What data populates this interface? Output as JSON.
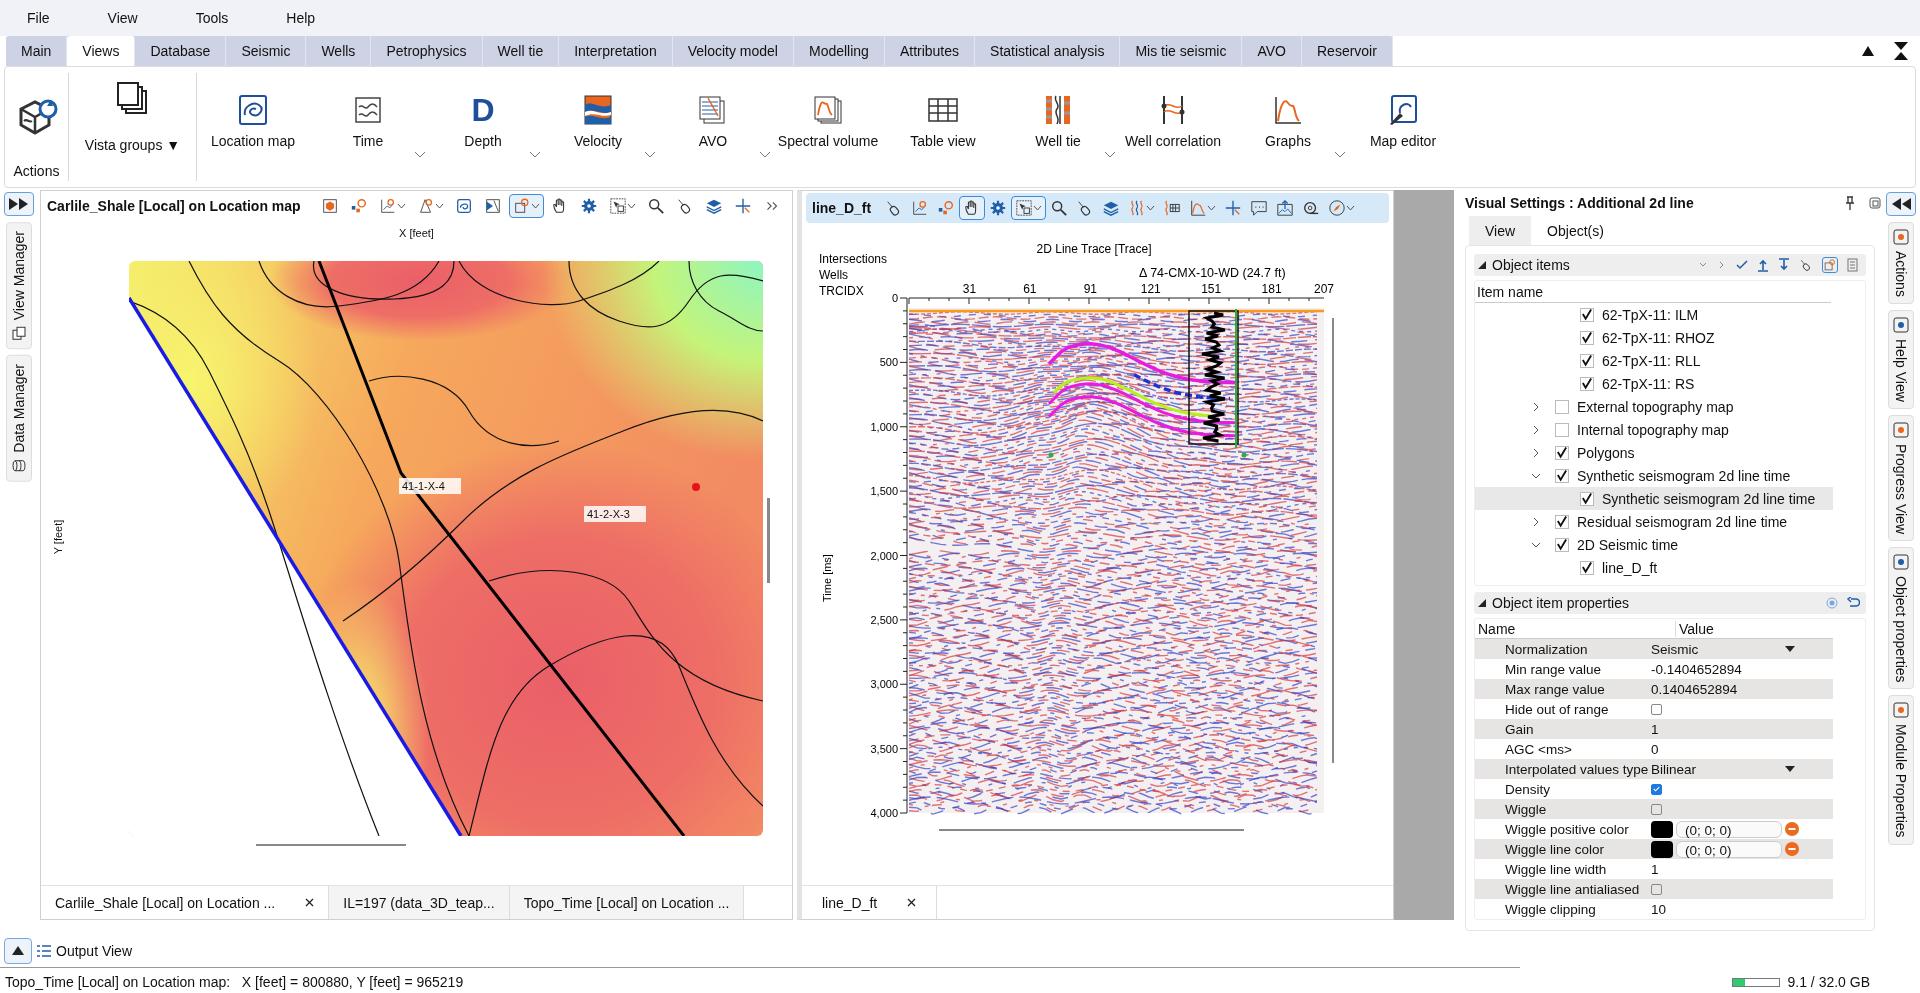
{
  "menu": [
    "File",
    "View",
    "Tools",
    "Help"
  ],
  "tabs": [
    {
      "label": "Main",
      "selected": false
    },
    {
      "label": "Views",
      "selected": true
    },
    {
      "label": "Database",
      "selected": false
    },
    {
      "label": "Seismic",
      "selected": false
    },
    {
      "label": "Wells",
      "selected": false
    },
    {
      "label": "Petrophysics",
      "selected": false
    },
    {
      "label": "Well tie",
      "selected": false
    },
    {
      "label": "Interpretation",
      "selected": false
    },
    {
      "label": "Velocity model",
      "selected": false
    },
    {
      "label": "Modelling",
      "selected": false
    },
    {
      "label": "Attributes",
      "selected": false
    },
    {
      "label": "Statistical analysis",
      "selected": false
    },
    {
      "label": "Mis tie seismic",
      "selected": false
    },
    {
      "label": "AVO",
      "selected": false
    },
    {
      "label": "Reservoir",
      "selected": false
    }
  ],
  "ribbon": {
    "actions_label": "Actions",
    "vista_groups": "Vista groups ▼",
    "buttons": [
      {
        "label": "Location map",
        "dropdown": false
      },
      {
        "label": "Time",
        "dropdown": true
      },
      {
        "label": "Depth",
        "dropdown": true,
        "glyph": "D"
      },
      {
        "label": "Velocity",
        "dropdown": true
      },
      {
        "label": "AVO",
        "dropdown": true
      },
      {
        "label": "Spectral volume",
        "dropdown": false
      },
      {
        "label": "Table view",
        "dropdown": false
      },
      {
        "label": "Well tie",
        "dropdown": true
      },
      {
        "label": "Well correlation",
        "dropdown": false
      },
      {
        "label": "Graphs",
        "dropdown": true
      },
      {
        "label": "Map editor",
        "dropdown": false
      }
    ]
  },
  "left_sidebar": [
    "View Manager",
    "Data Manager"
  ],
  "map_view": {
    "title": "Carlile_Shale [Local] on Location map",
    "toolbar": [
      {
        "selected": false
      },
      {
        "selected": false
      },
      {
        "selected": false
      },
      {
        "selected": false
      },
      {
        "selected": false
      },
      {
        "selected": false
      },
      {
        "selected": true
      },
      {
        "selected": false
      },
      {
        "selected": false
      },
      {
        "selected": false
      },
      {
        "selected": false
      },
      {
        "selected": false
      },
      {
        "selected": false
      },
      {
        "selected": false
      },
      {
        "selected": false
      }
    ],
    "x_axis": "X [feet]",
    "y_axis": "Y [feet]",
    "wells": [
      "41-1-X-4",
      "41-2-X-3"
    ],
    "tabs": [
      {
        "label": "Carlile_Shale [Local] on Location ...",
        "selected": true
      },
      {
        "label": "IL=197 (data_3D_teap...",
        "selected": false
      },
      {
        "label": "Topo_Time [Local] on Location ...",
        "selected": false
      }
    ]
  },
  "seismic_view": {
    "title": "line_D_ft",
    "toolbar": [
      {
        "selected": false
      },
      {
        "selected": false
      },
      {
        "selected": false
      },
      {
        "selected": true
      },
      {
        "selected": false
      },
      {
        "selected": true
      },
      {
        "selected": false
      },
      {
        "selected": false
      },
      {
        "selected": false
      },
      {
        "selected": false
      },
      {
        "selected": false
      },
      {
        "selected": false
      },
      {
        "selected": false
      },
      {
        "selected": false
      },
      {
        "selected": false
      },
      {
        "selected": false
      },
      {
        "selected": false
      }
    ],
    "x_axis": "2D Line Trace [Trace]",
    "row_labels": [
      "Intersections",
      "Wells",
      "TRCIDX"
    ],
    "well_marker": "Δ 74-CMX-10-WD (24.7 ft)",
    "xticks": [
      "31",
      "61",
      "91",
      "121",
      "151",
      "181",
      "207"
    ],
    "yticks": [
      "0",
      "500",
      "1,000",
      "1,500",
      "2,000",
      "2,500",
      "3,000",
      "3,500",
      "4,000"
    ],
    "y_axis": "Time [ms]",
    "tabs": [
      {
        "label": "line_D_ft",
        "selected": true
      }
    ]
  },
  "visual_settings": {
    "title": "Visual Settings : Additional 2d line",
    "tabs": [
      {
        "label": "View",
        "selected": true
      },
      {
        "label": "Object(s)",
        "selected": false
      }
    ],
    "object_items": {
      "title": "Object items",
      "column": "Item name",
      "continued_children": [
        {
          "label": "62-TpX-11: ILM",
          "checked": true,
          "selected": false
        },
        {
          "label": "62-TpX-11: RHOZ",
          "checked": true,
          "selected": false
        },
        {
          "label": "62-TpX-11: RLL",
          "checked": true,
          "selected": false
        },
        {
          "label": "62-TpX-11: RS",
          "checked": true,
          "selected": false
        }
      ],
      "items": [
        {
          "label": "External topography map",
          "checked": false,
          "expanded": false,
          "selected": false
        },
        {
          "label": "Internal topography map",
          "checked": false,
          "expanded": false,
          "selected": false
        },
        {
          "label": "Polygons",
          "checked": true,
          "expanded": false,
          "selected": false
        },
        {
          "label": "Synthetic seismogram 2d line time",
          "checked": true,
          "expanded": true,
          "selected": false,
          "children": [
            {
              "label": "Synthetic seismogram 2d line time",
              "checked": true,
              "selected": true
            }
          ]
        },
        {
          "label": "Residual seismogram 2d line time",
          "checked": true,
          "expanded": false,
          "selected": false
        },
        {
          "label": "2D Seismic time",
          "checked": true,
          "expanded": true,
          "selected": false,
          "children": [
            {
              "label": "line_D_ft",
              "checked": true,
              "selected": false
            }
          ]
        }
      ]
    },
    "properties": {
      "title": "Object item properties",
      "columns": [
        "Name",
        "Value"
      ],
      "rows": [
        {
          "name": "Normalization",
          "kind": "dropdown",
          "value": "Seismic"
        },
        {
          "name": "Min range value",
          "kind": "text",
          "value": "-0.1404652894"
        },
        {
          "name": "Max range value",
          "kind": "text",
          "value": "0.1404652894"
        },
        {
          "name": "Hide out of range",
          "kind": "checkbox",
          "checked": false
        },
        {
          "name": "Gain",
          "kind": "text",
          "value": "1"
        },
        {
          "name": "AGC <ms>",
          "kind": "text",
          "value": "0"
        },
        {
          "name": "Interpolated values type",
          "kind": "dropdown",
          "value": "Bilinear"
        },
        {
          "name": "Density",
          "kind": "checkbox",
          "checked": true
        },
        {
          "name": "Wiggle",
          "kind": "checkbox",
          "checked": false
        },
        {
          "name": "Wiggle positive color",
          "kind": "color",
          "color": "#000000",
          "value": "(0; 0; 0)"
        },
        {
          "name": "Wiggle line color",
          "kind": "color",
          "color": "#000000",
          "value": "(0; 0; 0)"
        },
        {
          "name": "Wiggle line width",
          "kind": "text",
          "value": "1"
        },
        {
          "name": "Wiggle line antialiased",
          "kind": "checkbox",
          "checked": false
        },
        {
          "name": "Wiggle clipping",
          "kind": "text",
          "value": "10"
        }
      ]
    }
  },
  "right_sidebar": [
    "Actions",
    "Help View",
    "Progress View",
    "Object properties",
    "Module Properties"
  ],
  "output_view": "Output View",
  "status": {
    "text": "Topo_Time [Local] on Location map:   X [feet] = 800880, Y [feet] = 965219",
    "memory": "9.1 / 32.0 GB",
    "level": 0.27
  }
}
